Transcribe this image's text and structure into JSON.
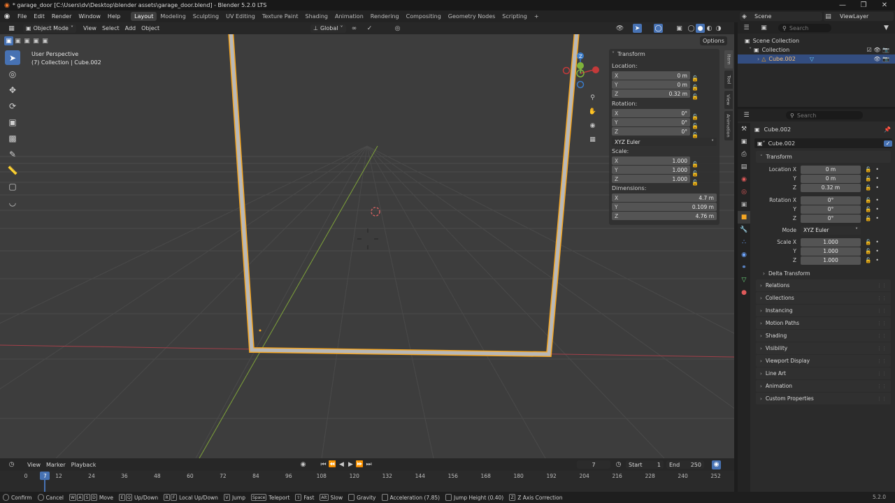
{
  "window": {
    "title": "* garage_door [C:\\Users\\dv\\Desktop\\blender assets\\garage_door.blend] - Blender 5.2.0 LTS",
    "minimize": "—",
    "maximize": "❐",
    "close": "✕"
  },
  "menu": {
    "items": [
      "File",
      "Edit",
      "Render",
      "Window",
      "Help"
    ],
    "workspaces": [
      "Layout",
      "Modeling",
      "Sculpting",
      "UV Editing",
      "Texture Paint",
      "Shading",
      "Animation",
      "Rendering",
      "Compositing",
      "Geometry Nodes",
      "Scripting"
    ],
    "add_workspace": "+",
    "scene": "Scene",
    "view_layer": "ViewLayer"
  },
  "viewport_header": {
    "mode": "Object Mode",
    "menus": [
      "View",
      "Select",
      "Add",
      "Object"
    ],
    "orientation": "Global",
    "options": "Options"
  },
  "viewport": {
    "perspective": "User Perspective",
    "collection_info": "(7) Collection | Cube.002",
    "gizmo_z": "Z"
  },
  "npanel": {
    "section": "Transform",
    "location_label": "Location:",
    "location": [
      {
        "axis": "X",
        "value": "0 m"
      },
      {
        "axis": "Y",
        "value": "0 m"
      },
      {
        "axis": "Z",
        "value": "0.32 m"
      }
    ],
    "rotation_label": "Rotation:",
    "rotation": [
      {
        "axis": "X",
        "value": "0°"
      },
      {
        "axis": "Y",
        "value": "0°"
      },
      {
        "axis": "Z",
        "value": "0°"
      }
    ],
    "rotation_mode": "XYZ Euler",
    "scale_label": "Scale:",
    "scale": [
      {
        "axis": "X",
        "value": "1.000"
      },
      {
        "axis": "Y",
        "value": "1.000"
      },
      {
        "axis": "Z",
        "value": "1.000"
      }
    ],
    "dimensions_label": "Dimensions:",
    "dimensions": [
      {
        "axis": "X",
        "value": "4.7 m"
      },
      {
        "axis": "Y",
        "value": "0.109 m"
      },
      {
        "axis": "Z",
        "value": "4.76 m"
      }
    ],
    "tabs": [
      "Item",
      "Tool",
      "View",
      "Animation"
    ]
  },
  "outliner": {
    "search_placeholder": "Search",
    "root": "Scene Collection",
    "collection": "Collection",
    "object": "Cube.002"
  },
  "properties": {
    "search_placeholder": "Search",
    "object_name": "Cube.002",
    "object_field": "Cube.002",
    "transform_section": "Transform",
    "location": [
      {
        "label": "Location X",
        "value": "0 m"
      },
      {
        "label": "Y",
        "value": "0 m"
      },
      {
        "label": "Z",
        "value": "0.32 m"
      }
    ],
    "rotation": [
      {
        "label": "Rotation X",
        "value": "0°"
      },
      {
        "label": "Y",
        "value": "0°"
      },
      {
        "label": "Z",
        "value": "0°"
      }
    ],
    "mode_label": "Mode",
    "mode_value": "XYZ Euler",
    "scale": [
      {
        "label": "Scale X",
        "value": "1.000"
      },
      {
        "label": "Y",
        "value": "1.000"
      },
      {
        "label": "Z",
        "value": "1.000"
      }
    ],
    "delta_transform": "Delta Transform",
    "sections": [
      "Relations",
      "Collections",
      "Instancing",
      "Motion Paths",
      "Shading",
      "Visibility",
      "Viewport Display",
      "Line Art",
      "Animation",
      "Custom Properties"
    ]
  },
  "timeline": {
    "menus": [
      "View",
      "Marker",
      "Playback"
    ],
    "current_frame": "7",
    "start_label": "Start",
    "start": "1",
    "end_label": "End",
    "end": "250",
    "playhead": "7",
    "ticks": [
      "0",
      "12",
      "24",
      "36",
      "48",
      "60",
      "72",
      "84",
      "96",
      "108",
      "120",
      "132",
      "144",
      "156",
      "168",
      "180",
      "192",
      "204",
      "216",
      "228",
      "240",
      "252"
    ]
  },
  "status": {
    "items": [
      {
        "keys": [],
        "label": "Confirm"
      },
      {
        "keys": [],
        "label": "Cancel"
      },
      {
        "keys": [
          "W",
          "A",
          "S",
          "D"
        ],
        "label": "Move"
      },
      {
        "keys": [
          "E",
          "Q"
        ],
        "label": "Up/Down"
      },
      {
        "keys": [
          "R",
          "F"
        ],
        "label": "Local Up/Down"
      },
      {
        "keys": [
          "V"
        ],
        "label": "Jump"
      },
      {
        "keys": [
          "Space"
        ],
        "label": "Teleport"
      },
      {
        "keys": [
          "⇧"
        ],
        "label": "Fast"
      },
      {
        "keys": [
          "Alt"
        ],
        "label": "Slow"
      },
      {
        "keys": [
          ""
        ],
        "label": "Gravity"
      },
      {
        "keys": [
          ""
        ],
        "label": "Acceleration (7.85)"
      },
      {
        "keys": [
          ""
        ],
        "label": "Jump Height (0.40)"
      },
      {
        "keys": [
          "Z"
        ],
        "label": "Z Axis Correction"
      }
    ],
    "version": "5.2.0"
  },
  "colors": {
    "accent": "#4772b3",
    "selection": "#f5a623",
    "x_axis": "#c43a3a",
    "y_axis": "#7fb33a"
  }
}
